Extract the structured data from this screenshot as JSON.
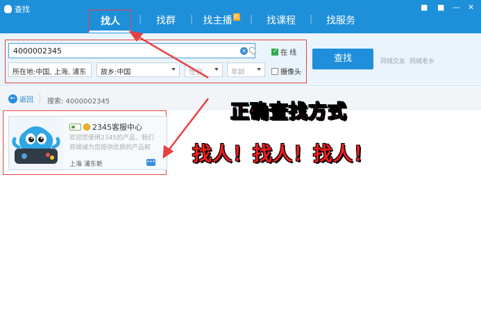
{
  "window": {
    "title": "查找",
    "controls": [
      "■",
      "■",
      "—",
      "✕"
    ]
  },
  "tabs": [
    {
      "label": "找人",
      "active": true
    },
    {
      "label": "找群"
    },
    {
      "label": "找主播",
      "badge": "热"
    },
    {
      "label": "找课程"
    },
    {
      "label": "找服务"
    }
  ],
  "search": {
    "keyword": "4000002345",
    "location": "所在地:中国, 上海, 浦东",
    "hometown": "故乡:中国",
    "gender_placeholder": "性别",
    "age_placeholder": "年龄",
    "online_label": "在 线",
    "online_checked": true,
    "camera_label": "摄像头",
    "camera_checked": false,
    "button_label": "查找",
    "link_friends": "同城交友",
    "link_villagers": "同城老乡"
  },
  "result_bar": {
    "back_label": "返回",
    "summary": "搜索:  4000002345"
  },
  "result": {
    "name": "2345客服中心",
    "description": "欢迎您使用2345的产品，我们将竭诚为您提供优质的产品和",
    "location": "上海  浦东新"
  },
  "annotations": {
    "title": "正确查找方式",
    "subtitle": "找人！找人！找人！",
    "color": "#ef1d1d"
  },
  "colors": {
    "accent": "#1e8fd9",
    "button": "#1f8fdc",
    "highlight_box": "#e84040"
  }
}
